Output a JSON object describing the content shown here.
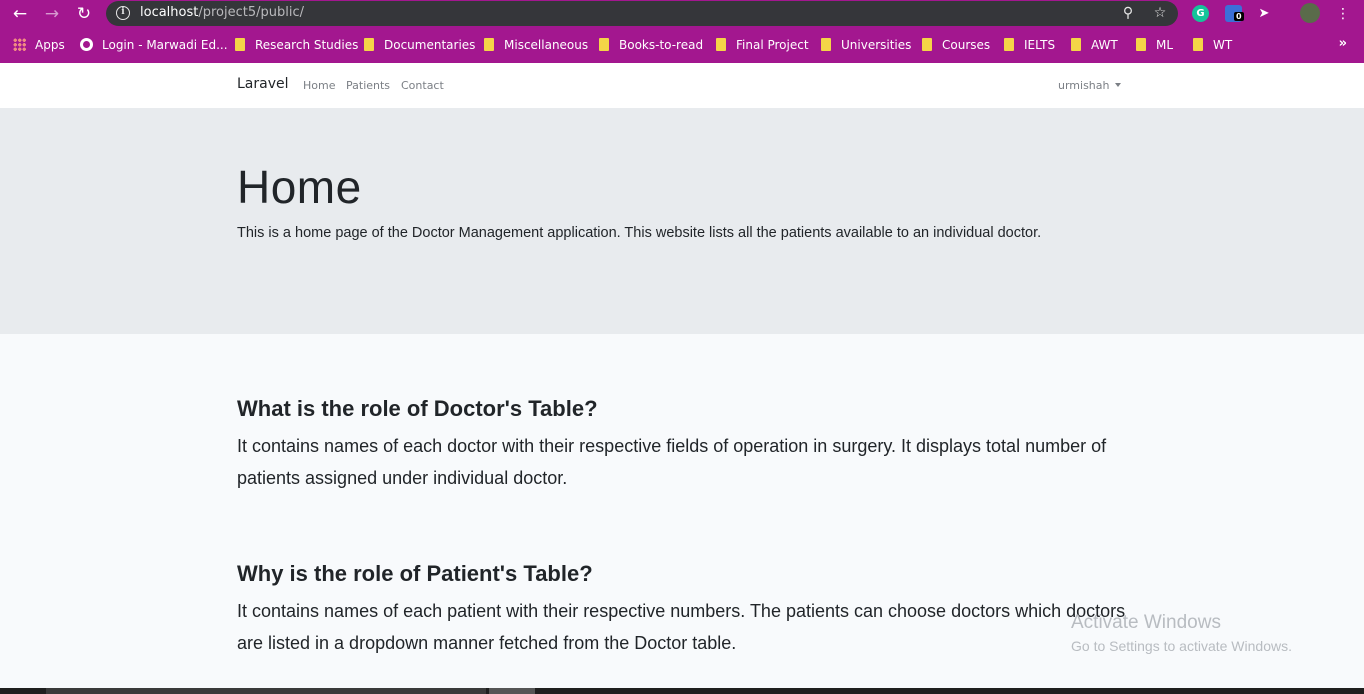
{
  "browser": {
    "url_host": "localhost",
    "url_path": "/project5/public/",
    "bookmarks": [
      {
        "label": "Apps",
        "kind": "apps"
      },
      {
        "label": "Login - Marwadi Ed...",
        "kind": "globe"
      },
      {
        "label": "Research Studies",
        "kind": "folder"
      },
      {
        "label": "Documentaries",
        "kind": "folder"
      },
      {
        "label": "Miscellaneous",
        "kind": "folder"
      },
      {
        "label": "Books-to-read",
        "kind": "folder"
      },
      {
        "label": "Final Project",
        "kind": "folder"
      },
      {
        "label": "Universities",
        "kind": "folder"
      },
      {
        "label": "Courses",
        "kind": "folder"
      },
      {
        "label": "IELTS",
        "kind": "folder"
      },
      {
        "label": "AWT",
        "kind": "folder"
      },
      {
        "label": "ML",
        "kind": "folder"
      },
      {
        "label": "WT",
        "kind": "folder"
      }
    ],
    "bookmarks_overflow": "»",
    "extension_badge": "0",
    "chrome_color": "#a3178f"
  },
  "navbar": {
    "brand": "Laravel",
    "links": [
      "Home",
      "Patients",
      "Contact"
    ],
    "user": "urmishah"
  },
  "jumbotron": {
    "title": "Home",
    "description": "This is a home page of the Doctor Management application. This website lists all the patients available to an individual doctor."
  },
  "sections": [
    {
      "title": "What is the role of Doctor's Table?",
      "body": "It contains names of each doctor with their respective fields of operation in surgery. It displays total number of patients assigned under individual doctor."
    },
    {
      "title": "Why is the role of Patient's Table?",
      "body": "It contains names of each patient with their respective numbers. The patients can choose doctors which doctors are listed in a dropdown manner fetched from the Doctor table."
    }
  ],
  "watermark": {
    "line1": "Activate Windows",
    "line2": "Go to Settings to activate Windows."
  }
}
